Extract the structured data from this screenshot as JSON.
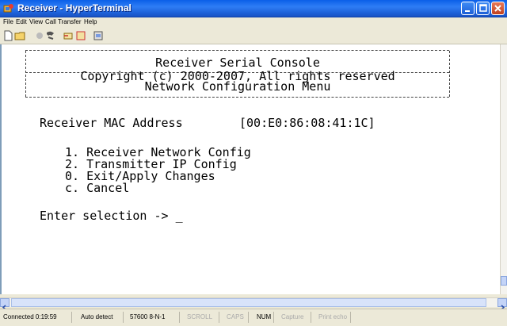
{
  "window": {
    "title": "Receiver - HyperTerminal"
  },
  "menu": [
    "File",
    "Edit",
    "View",
    "Call",
    "Transfer",
    "Help"
  ],
  "toolbar": {
    "icons": [
      "new-file-icon",
      "open-folder-icon",
      "call-icon",
      "disconnect-icon",
      "send-icon",
      "receive-icon",
      "properties-icon"
    ]
  },
  "console": {
    "header_title": "Receiver Serial Console",
    "copyright": "Copyright (c) 2000-2007, All rights reserved",
    "menu_title": "Network Configuration Menu",
    "mac_label": "Receiver MAC Address",
    "mac_value": "[00:E0:86:08:41:1C]",
    "options": [
      "1. Receiver Network Config",
      "2. Transmitter IP Config",
      "0. Exit/Apply Changes",
      "c. Cancel"
    ],
    "prompt": "Enter selection -> _"
  },
  "status": {
    "connected": "Connected 0:19:59",
    "detect": "Auto detect",
    "settings": "57600 8-N-1",
    "scroll": "SCROLL",
    "caps": "CAPS",
    "num": "NUM",
    "capture": "Capture",
    "print_echo": "Print echo"
  }
}
